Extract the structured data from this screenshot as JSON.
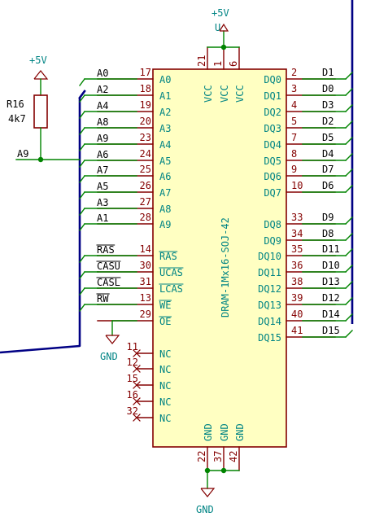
{
  "colors": {
    "body_fill": "#ffffc2",
    "body_stroke": "#840000",
    "pin_name": "#008484",
    "pin_number": "#840000",
    "wire": "#008400",
    "bus": "#000084",
    "net_label": "#000000",
    "junction": "#008400",
    "power": "#840000"
  },
  "ic": {
    "part_name": "DRAM-1Mx16-SOJ-42",
    "left_pins": [
      {
        "name": "A0",
        "num": "17",
        "net": "A0"
      },
      {
        "name": "A1",
        "num": "18",
        "net": "A2"
      },
      {
        "name": "A2",
        "num": "19",
        "net": "A4"
      },
      {
        "name": "A3",
        "num": "20",
        "net": "A8"
      },
      {
        "name": "A4",
        "num": "23",
        "net": "A9"
      },
      {
        "name": "A5",
        "num": "24",
        "net": "A6"
      },
      {
        "name": "A6",
        "num": "25",
        "net": "A7"
      },
      {
        "name": "A7",
        "num": "26",
        "net": "A5"
      },
      {
        "name": "A8",
        "num": "27",
        "net": "A3"
      },
      {
        "name": "A9",
        "num": "28",
        "net": "A1"
      },
      {
        "name": "RAS",
        "num": "14",
        "net": "RAS"
      },
      {
        "name": "UCAS",
        "num": "30",
        "net": "CASU"
      },
      {
        "name": "LCAS",
        "num": "31",
        "net": "CASL"
      },
      {
        "name": "WE",
        "num": "13",
        "net": "RW"
      },
      {
        "name": "OE",
        "num": "29",
        "net": ""
      },
      {
        "name": "NC",
        "num": "11",
        "net": ""
      },
      {
        "name": "NC",
        "num": "12",
        "net": ""
      },
      {
        "name": "NC",
        "num": "15",
        "net": ""
      },
      {
        "name": "NC",
        "num": "16",
        "net": ""
      },
      {
        "name": "NC",
        "num": "32",
        "net": ""
      }
    ],
    "right_pins": [
      {
        "name": "DQ0",
        "num": "2",
        "net": "D1"
      },
      {
        "name": "DQ1",
        "num": "3",
        "net": "D0"
      },
      {
        "name": "DQ2",
        "num": "4",
        "net": "D3"
      },
      {
        "name": "DQ3",
        "num": "5",
        "net": "D2"
      },
      {
        "name": "DQ4",
        "num": "7",
        "net": "D5"
      },
      {
        "name": "DQ5",
        "num": "8",
        "net": "D4"
      },
      {
        "name": "DQ6",
        "num": "9",
        "net": "D7"
      },
      {
        "name": "DQ7",
        "num": "10",
        "net": "D6"
      },
      {
        "name": "DQ8",
        "num": "33",
        "net": "D9"
      },
      {
        "name": "DQ9",
        "num": "34",
        "net": "D8"
      },
      {
        "name": "DQ10",
        "num": "35",
        "net": "D11"
      },
      {
        "name": "DQ11",
        "num": "36",
        "net": "D10"
      },
      {
        "name": "DQ12",
        "num": "38",
        "net": "D13"
      },
      {
        "name": "DQ13",
        "num": "39",
        "net": "D12"
      },
      {
        "name": "DQ14",
        "num": "40",
        "net": "D14"
      },
      {
        "name": "DQ15",
        "num": "41",
        "net": "D15"
      }
    ],
    "top_pins": [
      {
        "name": "VCC",
        "num": "21"
      },
      {
        "name": "VCC",
        "num": "1"
      },
      {
        "name": "VCC",
        "num": "6"
      }
    ],
    "bottom_pins": [
      {
        "name": "GND",
        "num": "22"
      },
      {
        "name": "GND",
        "num": "37"
      },
      {
        "name": "GND",
        "num": "42"
      }
    ]
  },
  "resistor": {
    "ref": "R16",
    "value": "4k7",
    "net": "A9",
    "supply": "+5V"
  },
  "power": {
    "vcc_label": "+5V",
    "vcc_sub": "U",
    "oe_gnd": "GND",
    "bottom_gnd": "GND"
  }
}
